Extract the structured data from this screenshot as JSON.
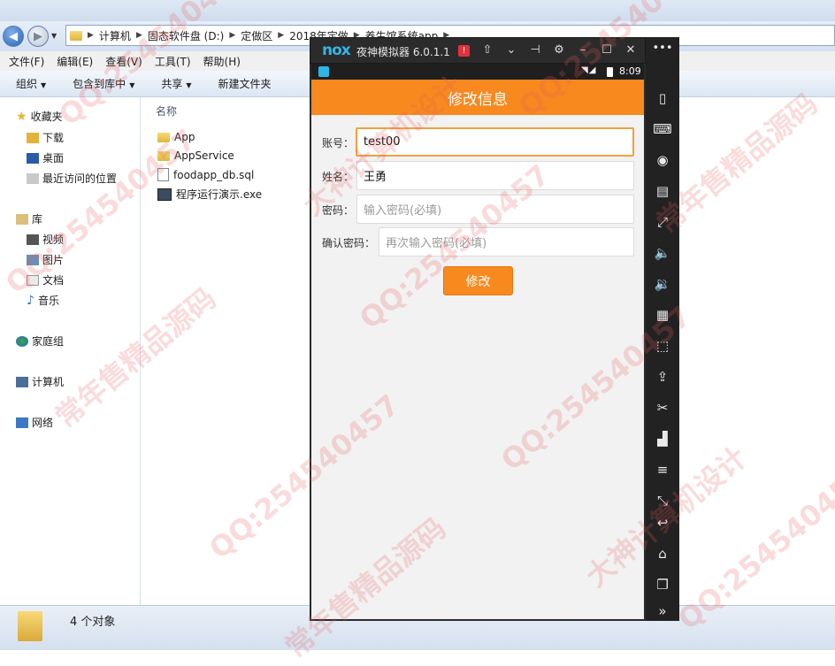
{
  "explorer": {
    "breadcrumbs": [
      "计算机",
      "固态软件盘 (D:)",
      "定做区",
      "2018年定做",
      "养生馆系统app"
    ],
    "menu": [
      "文件(F)",
      "编辑(E)",
      "查看(V)",
      "工具(T)",
      "帮助(H)"
    ],
    "toolbar": [
      "组织",
      "包含到库中",
      "共享",
      "新建文件夹"
    ],
    "nav": {
      "favorites": "收藏夹",
      "downloads": "下载",
      "desktop": "桌面",
      "recent": "最近访问的位置",
      "libraries": "库",
      "videos": "视频",
      "pictures": "图片",
      "documents": "文档",
      "music": "音乐",
      "homegroup": "家庭组",
      "computer": "计算机",
      "network": "网络"
    },
    "column_name": "名称",
    "files": [
      {
        "name": "App",
        "icon": "folder-icon"
      },
      {
        "name": "AppService",
        "icon": "folder-icon"
      },
      {
        "name": "foodapp_db.sql",
        "icon": "sql-file-icon"
      },
      {
        "name": "程序运行演示.exe",
        "icon": "exe-file-icon"
      }
    ],
    "status_count": "4 个对象"
  },
  "emulator": {
    "logo": "nox",
    "title": "夜神模拟器 6.0.1.1",
    "alert": "!",
    "time": "8:09",
    "app_title": "修改信息",
    "form": {
      "account_label": "账号：",
      "account_value": "test00",
      "name_label": "姓名：",
      "name_value": "王勇",
      "password_label": "密码：",
      "password_placeholder": "输入密码(必填)",
      "confirm_label": "确认密码：",
      "confirm_placeholder": "再次输入密码(必填)",
      "submit_label": "修改"
    }
  },
  "watermarks": [
    "QQ:254540457",
    "常年售精品源码",
    "大神计算机设计"
  ],
  "colors": {
    "accent": "#f7891f",
    "watermark": "#e65a5a",
    "emulator_frame": "#222222"
  }
}
